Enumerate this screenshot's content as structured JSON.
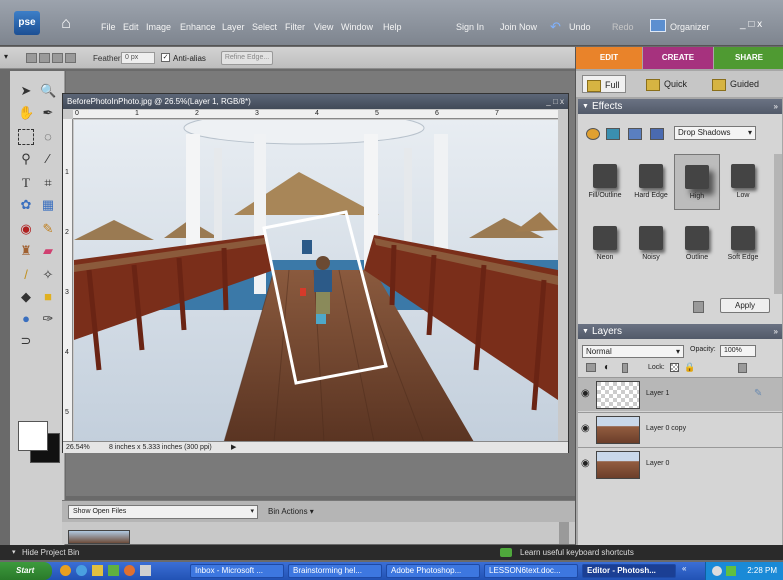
{
  "menubar": {
    "logo": "pse",
    "menus": [
      "File",
      "Edit",
      "Image",
      "Enhance",
      "Layer",
      "Select",
      "Filter",
      "View",
      "Window",
      "Help"
    ],
    "sign_in": "Sign In",
    "join_now": "Join Now",
    "undo": "Undo",
    "redo": "Redo",
    "organizer": "Organizer",
    "window_controls": "_ □ x"
  },
  "options": {
    "feather_label": "Feather:",
    "feather_value": "0 px",
    "anti_alias_label": "Anti-alias",
    "refine_edge": "Refine Edge..."
  },
  "document": {
    "title": "BeforePhotoInPhoto.jpg @ 26.5%(Layer 1, RGB/8*)",
    "controls": "_ □ x",
    "zoom": "26.54%",
    "doc_info": "8 inches x 5.333 inches (300 ppi)",
    "ruler_top": [
      "0",
      "1",
      "2",
      "3",
      "4",
      "5",
      "6",
      "7"
    ],
    "ruler_left": [
      "1",
      "2",
      "3",
      "4",
      "5"
    ]
  },
  "bin": {
    "select_value": "Show Open Files",
    "actions": "Bin Actions ▾"
  },
  "status_strip": {
    "hide_bin": "Hide Project Bin",
    "tip": "Learn useful keyboard shortcuts"
  },
  "right_panel": {
    "tabs": [
      {
        "label": "EDIT",
        "color": "#e9832a"
      },
      {
        "label": "CREATE",
        "color": "#a6327e"
      },
      {
        "label": "SHARE",
        "color": "#4f9a32"
      }
    ],
    "subtabs": [
      "Full",
      "Quick",
      "Guided"
    ],
    "effects": {
      "header": "Effects",
      "category": "Drop Shadows",
      "items": [
        "Fill/Outline",
        "Hard Edge",
        "High",
        "Low",
        "Neon",
        "Noisy",
        "Outline",
        "Soft Edge"
      ],
      "selected": "High",
      "apply": "Apply"
    },
    "layers": {
      "header": "Layers",
      "blend_mode": "Normal",
      "opacity_label": "Opacity:",
      "opacity_value": "100%",
      "lock_label": "Lock:",
      "items": [
        "Layer 1",
        "Layer 0 copy",
        "Layer 0"
      ]
    }
  },
  "taskbar": {
    "start": "Start",
    "tasks": [
      {
        "label": "Inbox - Microsoft ..."
      },
      {
        "label": "Brainstorming hel..."
      },
      {
        "label": "Adobe Photoshop..."
      },
      {
        "label": "LESSON6text.doc..."
      },
      {
        "label": "Editor - Photosh..."
      }
    ],
    "clock": "2:28 PM"
  }
}
